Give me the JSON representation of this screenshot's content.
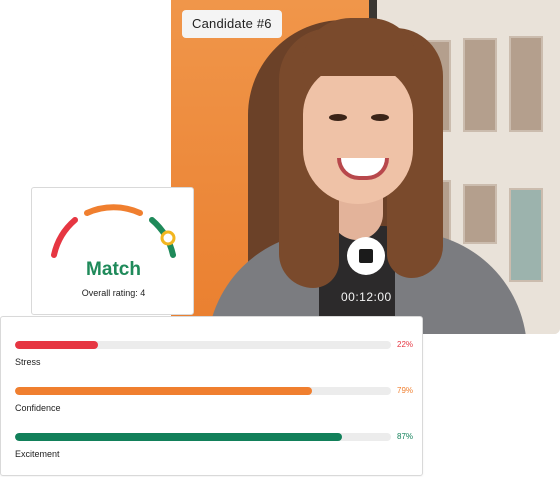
{
  "video": {
    "candidate_label": "Candidate #6",
    "timer": "00:12:00"
  },
  "match": {
    "title": "Match",
    "subtitle": "Overall rating: 4",
    "gauge_colors": [
      "#e63642",
      "#f07f2f",
      "#1f8a5a"
    ],
    "indicator_color": "#f2b61f"
  },
  "metrics": [
    {
      "label": "Stress",
      "value": 22,
      "display": "22%",
      "color": "#e63642"
    },
    {
      "label": "Confidence",
      "value": 79,
      "display": "79%",
      "color": "#f07f2f"
    },
    {
      "label": "Excitement",
      "value": 87,
      "display": "87%",
      "color": "#12805a"
    }
  ]
}
